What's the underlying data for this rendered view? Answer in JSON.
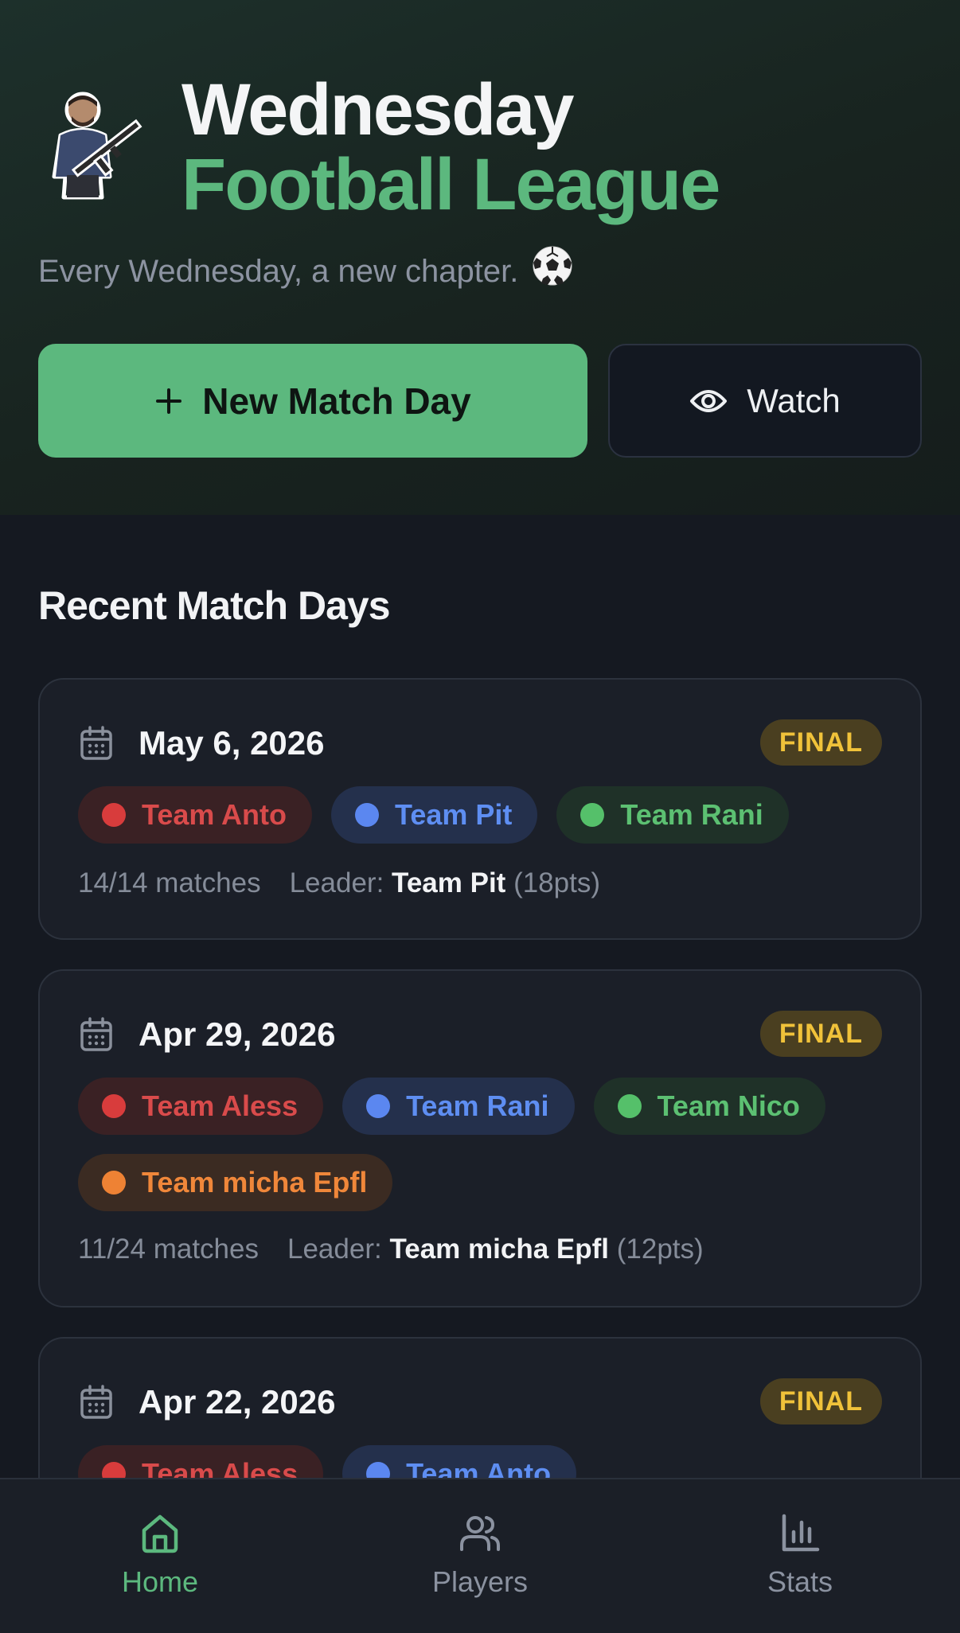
{
  "header": {
    "title_line1": "Wednesday",
    "title_line2": "Football League",
    "tagline": "Every Wednesday, a new chapter.",
    "tagline_emoji": "soccer-ball-icon",
    "logo": "player-with-rifle-mascot"
  },
  "actions": {
    "new_match_day": "New Match Day",
    "watch": "Watch"
  },
  "section": {
    "title": "Recent Match Days"
  },
  "match_days": [
    {
      "date": "May 6, 2026",
      "status": "FINAL",
      "teams": [
        {
          "name": "Team Anto",
          "color": "red"
        },
        {
          "name": "Team Pit",
          "color": "blue"
        },
        {
          "name": "Team Rani",
          "color": "green"
        }
      ],
      "matches": "14/14 matches",
      "leader_label": "Leader:",
      "leader": "Team Pit",
      "leader_points": "(18pts)"
    },
    {
      "date": "Apr 29, 2026",
      "status": "FINAL",
      "teams": [
        {
          "name": "Team Aless",
          "color": "red"
        },
        {
          "name": "Team Rani",
          "color": "blue"
        },
        {
          "name": "Team Nico",
          "color": "green"
        },
        {
          "name": "Team micha Epfl",
          "color": "orange"
        }
      ],
      "matches": "11/24 matches",
      "leader_label": "Leader:",
      "leader": "Team micha Epfl",
      "leader_points": "(12pts)"
    },
    {
      "date": "Apr 22, 2026",
      "status": "FINAL",
      "teams": [
        {
          "name": "Team Aless",
          "color": "red"
        },
        {
          "name": "Team Anto",
          "color": "blue"
        }
      ]
    }
  ],
  "nav": {
    "home": "Home",
    "players": "Players",
    "stats": "Stats",
    "active": "home"
  },
  "colors": {
    "accent": "#5cb87e",
    "background": "#151921",
    "card": "#1b1f28",
    "final_badge": "#f0c23a",
    "team_red": "#d83c3c",
    "team_blue": "#5b87f0",
    "team_green": "#55c06a",
    "team_orange": "#ee8234"
  }
}
